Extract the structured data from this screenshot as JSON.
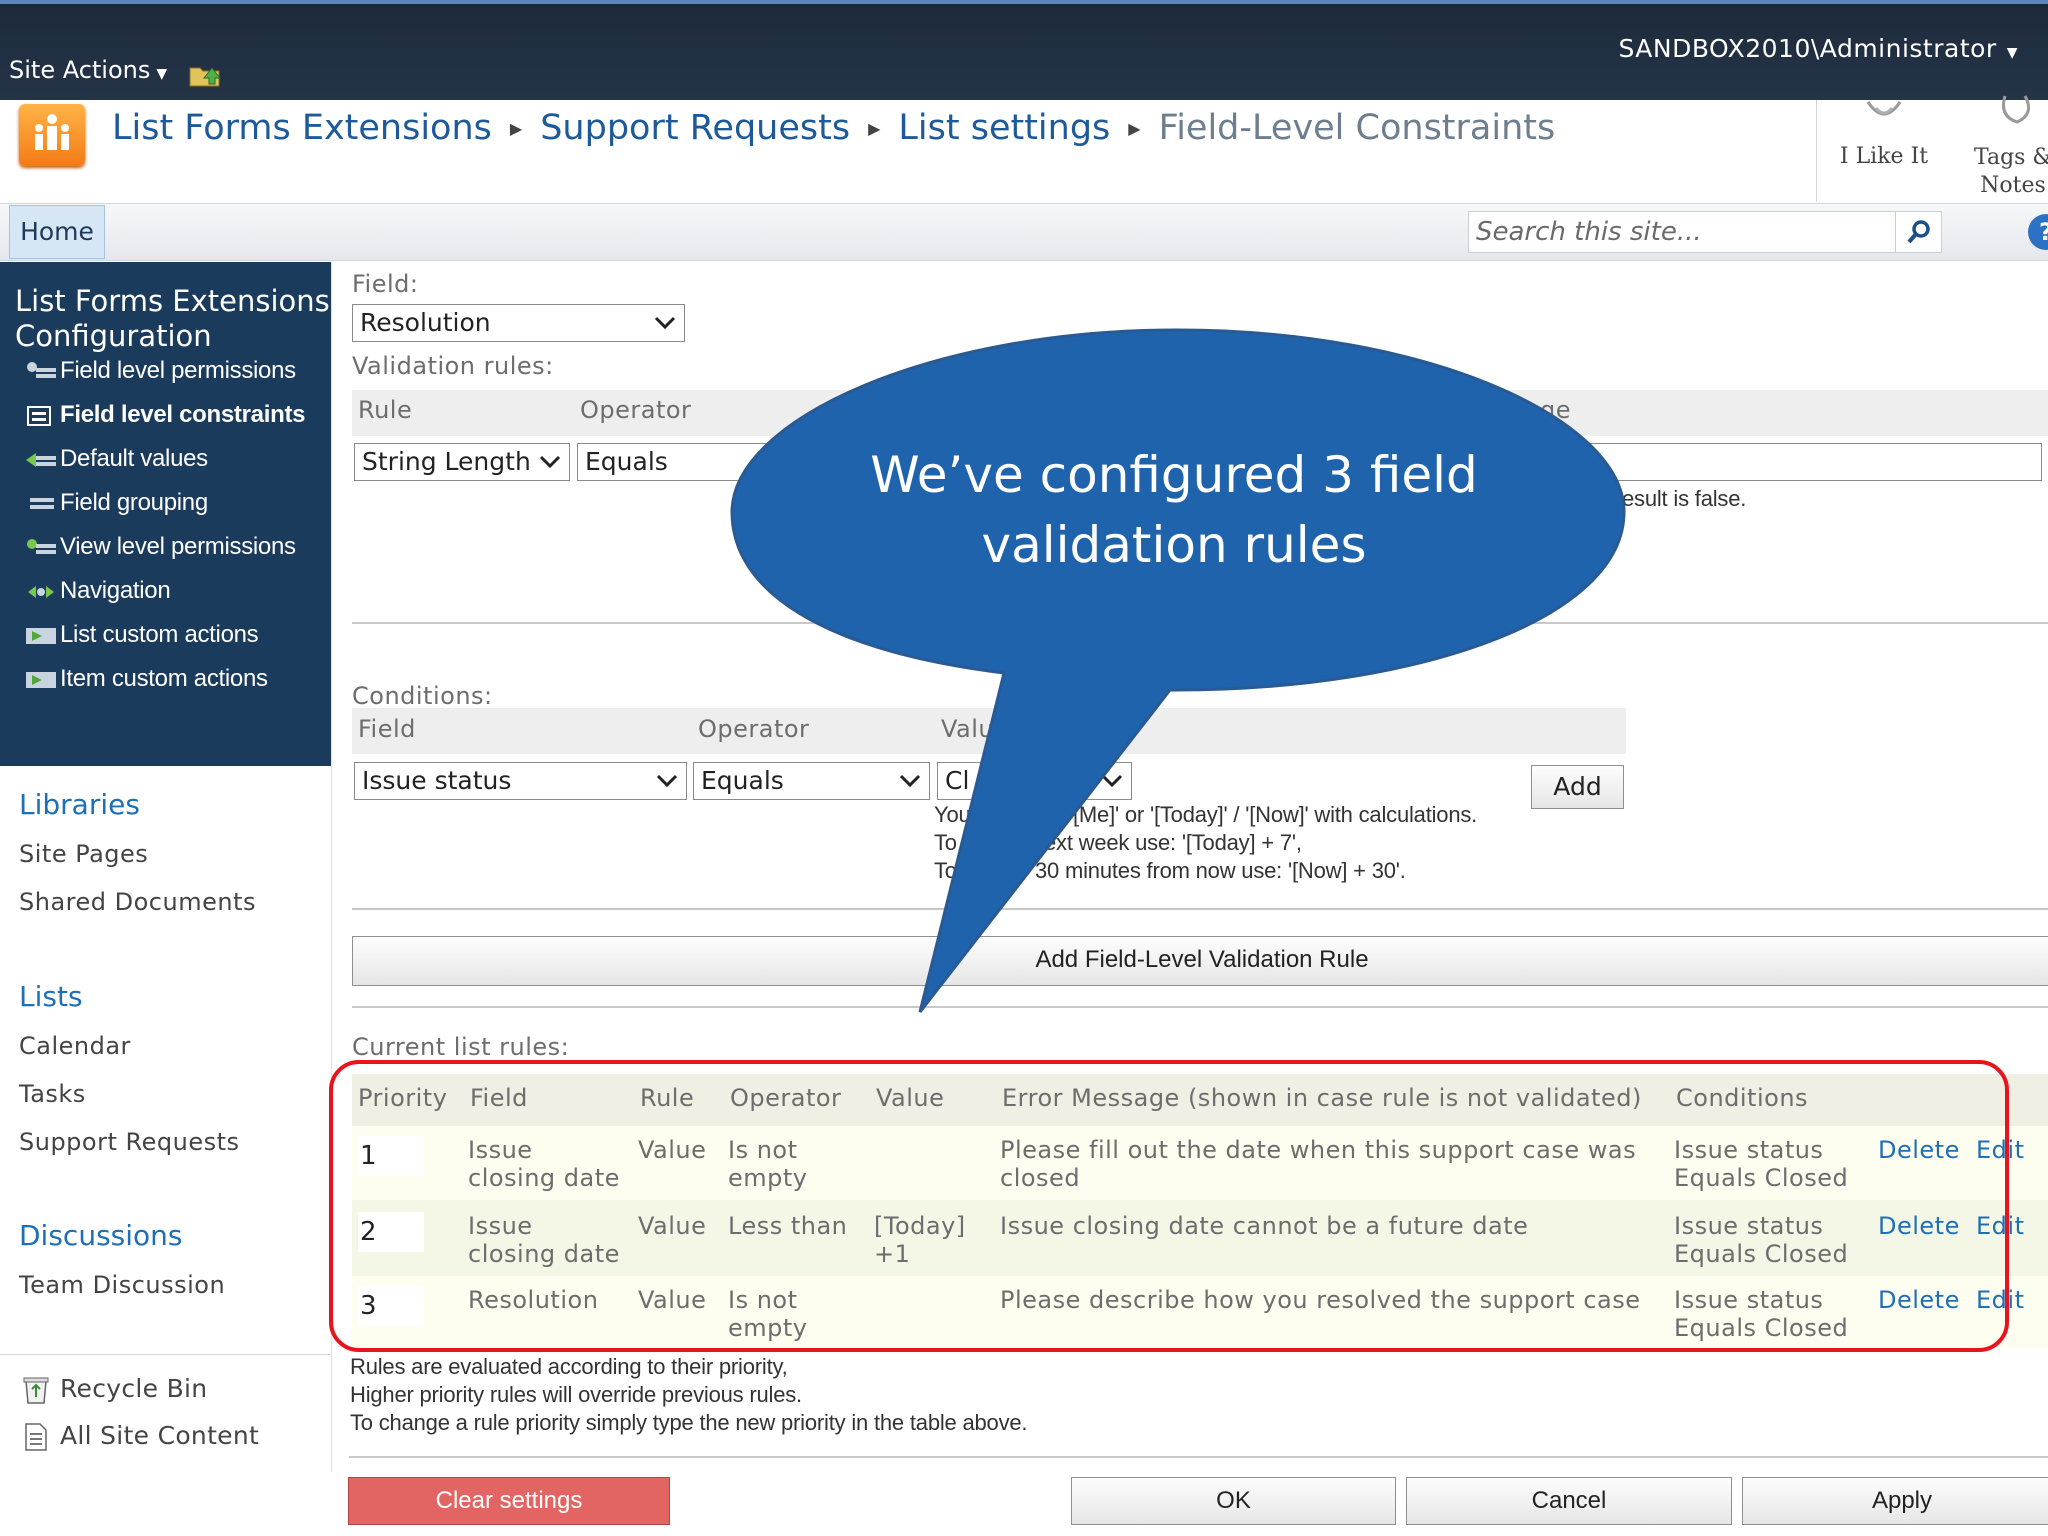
{
  "ribbon": {
    "site_actions": "Site Actions",
    "user": "SANDBOX2010\\Administrator"
  },
  "breadcrumb": {
    "items": [
      "List Forms Extensions",
      "Support Requests",
      "List settings"
    ],
    "current": "Field-Level Constraints"
  },
  "social": {
    "i_like_it": "I Like It",
    "tags_notes": "Tags & Notes"
  },
  "topnav": {
    "home": "Home",
    "search_placeholder": "Search this site..."
  },
  "config_nav": {
    "title": "List Forms Extensions Configuration",
    "items": [
      {
        "label": "Field level permissions",
        "icon": "permissions-icon"
      },
      {
        "label": "Field level constraints",
        "icon": "constraints-icon",
        "active": true
      },
      {
        "label": "Default values",
        "icon": "default-values-icon"
      },
      {
        "label": "Field grouping",
        "icon": "grouping-icon"
      },
      {
        "label": "View level permissions",
        "icon": "view-permissions-icon"
      },
      {
        "label": "Navigation",
        "icon": "navigation-icon"
      },
      {
        "label": "List custom actions",
        "icon": "list-actions-icon"
      },
      {
        "label": "Item custom actions",
        "icon": "item-actions-icon"
      }
    ]
  },
  "quicklaunch": {
    "libraries": {
      "heading": "Libraries",
      "items": [
        "Site Pages",
        "Shared Documents"
      ]
    },
    "lists": {
      "heading": "Lists",
      "items": [
        "Calendar",
        "Tasks",
        "Support Requests"
      ]
    },
    "discussions": {
      "heading": "Discussions",
      "items": [
        "Team Discussion"
      ]
    },
    "recycle_bin": "Recycle Bin",
    "all_site_content": "All Site Content"
  },
  "form": {
    "field_label": "Field:",
    "field_value": "Resolution",
    "validation_rules_label": "Validation rules:",
    "rule_header": {
      "rule": "Rule",
      "operator": "Operator",
      "message_tail": "ge"
    },
    "rule_value": "String Length",
    "operator_value": "Equals",
    "message_note_tail": "esult is false.",
    "conditions_label": "Conditions:",
    "cond_header": {
      "field": "Field",
      "operator": "Operator",
      "value": "Valu"
    },
    "cond_field": "Issue status",
    "cond_operator": "Equals",
    "cond_value": "Cl",
    "add": "Add",
    "help_lines": [
      {
        "left": "You",
        "right": "[Me]' or '[Today]' / '[Now]' with calculations."
      },
      {
        "left": "To",
        "right": "ext week use: '[Today] + 7',"
      },
      {
        "left": "To",
        "right": "30 minutes from now use: '[Now] + 30'."
      }
    ],
    "add_rule_button": "Add Field-Level Validation Rule",
    "current_rules_label": "Current list rules:"
  },
  "rules_table": {
    "headers": [
      "Priority",
      "Field",
      "Rule",
      "Operator",
      "Value",
      "Error Message (shown in case rule is not validated)",
      "Conditions"
    ],
    "rows": [
      {
        "priority": "1",
        "field": "Issue closing date",
        "rule": "Value",
        "operator": "Is not empty",
        "value": "",
        "message": "Please fill out the date when this support case was closed",
        "conditions": "Issue status Equals Closed",
        "delete": "Delete",
        "edit": "Edit"
      },
      {
        "priority": "2",
        "field": "Issue closing date",
        "rule": "Value",
        "operator": "Less than",
        "value": "[Today] +1",
        "message": "Issue closing date cannot be a future date",
        "conditions": "Issue status Equals Closed",
        "delete": "Delete",
        "edit": "Edit"
      },
      {
        "priority": "3",
        "field": "Resolution",
        "rule": "Value",
        "operator": "Is not empty",
        "value": "",
        "message": "Please describe how you resolved the support case",
        "conditions": "Issue status Equals Closed",
        "delete": "Delete",
        "edit": "Edit"
      }
    ]
  },
  "footer_notes": [
    "Rules are evaluated according to their priority,",
    "Higher priority rules will override previous rules.",
    "To change a rule priority simply type the new priority in the table above."
  ],
  "buttons": {
    "clear": "Clear settings",
    "ok": "OK",
    "cancel": "Cancel",
    "apply": "Apply"
  },
  "callout": {
    "text_line1": "We’ve configured 3 field",
    "text_line2": "validation rules",
    "color": "#1f63ad"
  },
  "highlight_color": "#e8131c"
}
